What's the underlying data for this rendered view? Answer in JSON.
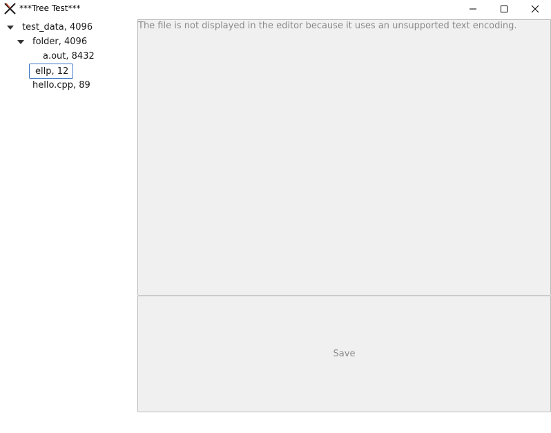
{
  "window": {
    "title": "***Tree Test***",
    "app_icon": "x-logo-icon",
    "controls": [
      "minimize-icon",
      "maximize-icon",
      "close-icon"
    ]
  },
  "tree": {
    "root": {
      "label": "test_data, 4096",
      "expanded": true
    },
    "folder": {
      "label": "folder, 4096",
      "expanded": true
    },
    "items": [
      {
        "label": "a.out, 8432"
      },
      {
        "label": "hello.cpp, 89"
      }
    ],
    "editing": {
      "value": "ellp, 12"
    }
  },
  "editor": {
    "message": "The file is not displayed in the editor because it uses an unsupported text encoding."
  },
  "actions": {
    "save_label": "Save"
  }
}
